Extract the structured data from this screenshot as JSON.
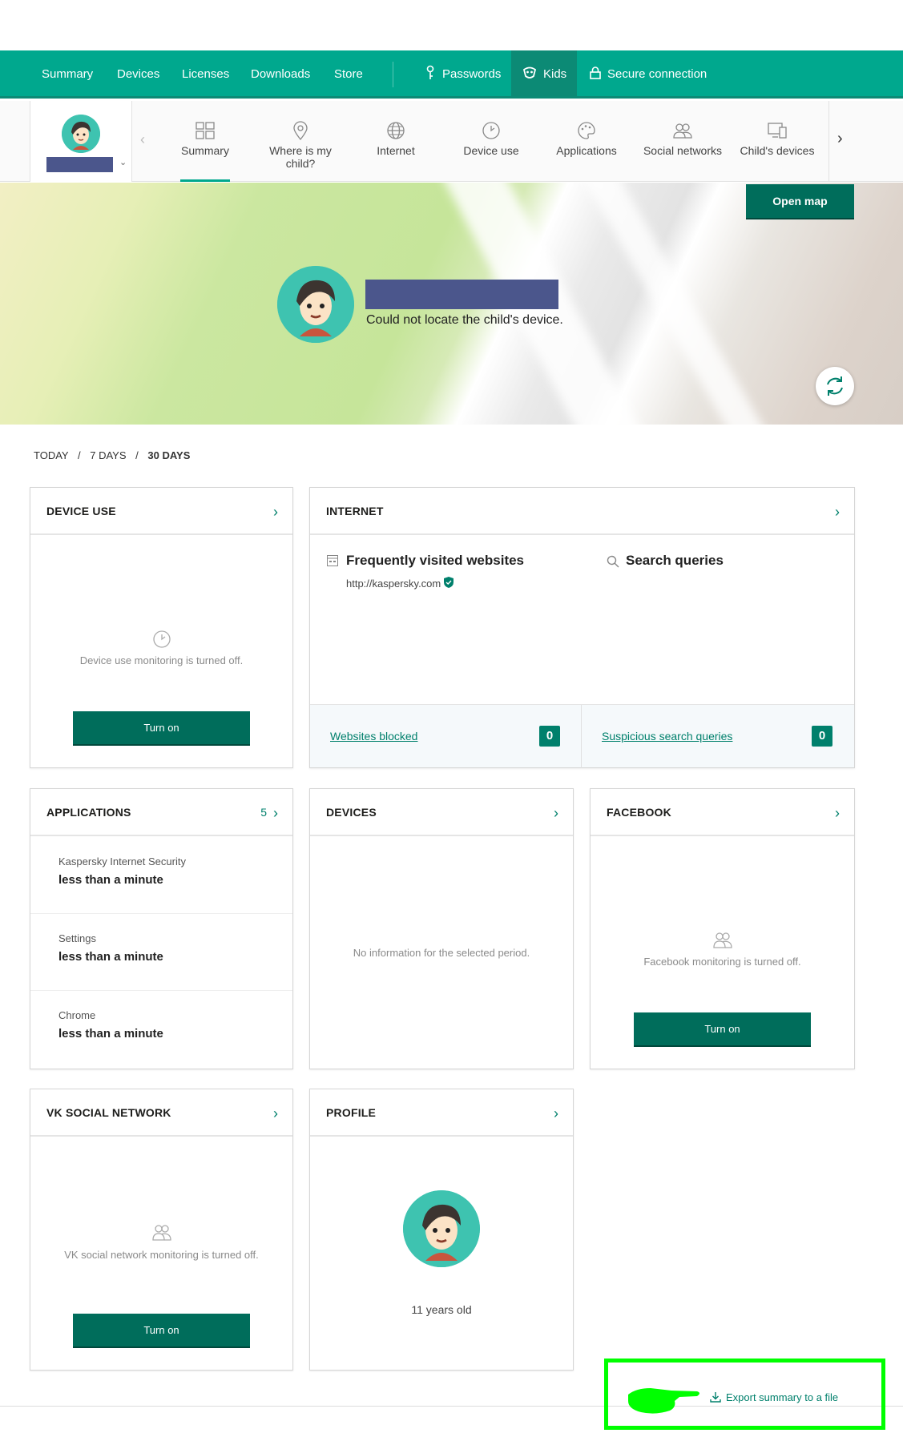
{
  "topnav": {
    "items": [
      "Summary",
      "Devices",
      "Licenses",
      "Downloads",
      "Store"
    ],
    "passwords": "Passwords",
    "kids": "Kids",
    "secure": "Secure connection"
  },
  "subnav": {
    "items": [
      "Summary",
      "Where is my child?",
      "Internet",
      "Device use",
      "Applications",
      "Social networks",
      "Child's devices"
    ]
  },
  "map": {
    "open_map": "Open map",
    "status": "Could not locate the child's device."
  },
  "period": {
    "today": "TODAY",
    "sep1": "/",
    "seven": "7 DAYS",
    "sep2": "/",
    "thirty": "30 DAYS"
  },
  "device_use": {
    "title": "DEVICE USE",
    "message": "Device use monitoring is turned off.",
    "button": "Turn on"
  },
  "internet": {
    "title": "INTERNET",
    "frequent_title": "Frequently visited websites",
    "site": "http://kaspersky.com",
    "search_title": "Search queries",
    "blocked_label": "Websites blocked",
    "blocked_count": "0",
    "suspicious_label": "Suspicious search queries",
    "suspicious_count": "0"
  },
  "applications": {
    "title": "APPLICATIONS",
    "count": "5",
    "items": [
      {
        "name": "Kaspersky Internet Security",
        "time": "less than a minute"
      },
      {
        "name": "Settings",
        "time": "less than a minute"
      },
      {
        "name": "Chrome",
        "time": "less than a minute"
      }
    ]
  },
  "devices": {
    "title": "DEVICES",
    "message": "No information for the selected period."
  },
  "facebook": {
    "title": "FACEBOOK",
    "message": "Facebook monitoring is turned off.",
    "button": "Turn on"
  },
  "vk": {
    "title": "VK SOCIAL NETWORK",
    "message": "VK social network monitoring is turned off.",
    "button": "Turn on"
  },
  "profile": {
    "title": "PROFILE",
    "age": "11 years old"
  },
  "export": {
    "label": "Export summary to a file"
  },
  "colors": {
    "brand": "#00a88e",
    "dark": "#006d5b",
    "redaction": "#4b568c",
    "highlight": "#00ff00"
  }
}
